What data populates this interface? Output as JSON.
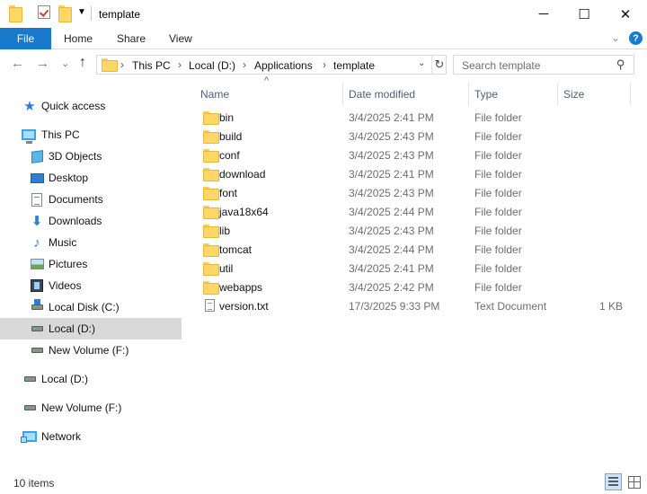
{
  "window": {
    "title": "template",
    "controls": {
      "minimize": "─",
      "maximize": "☐",
      "close": "✕"
    }
  },
  "ribbon": {
    "tabs": [
      "File",
      "Home",
      "Share",
      "View"
    ],
    "collapse_icon": "chevron-down-icon",
    "help_label": "?"
  },
  "address_bar": {
    "breadcrumbs": [
      "This PC",
      "Local (D:)",
      "Applications",
      "template"
    ],
    "separator": "›",
    "dropdown_glyph": "⌄",
    "refresh_glyph": "↻"
  },
  "search": {
    "placeholder": "Search template"
  },
  "nav_glyphs": {
    "back": "←",
    "forward": "→",
    "recent": "⌄",
    "up": "↑"
  },
  "nav_pane": {
    "items": [
      {
        "label": "Quick access",
        "icon": "star-icon"
      },
      {
        "label": "This PC",
        "icon": "computer-icon"
      },
      {
        "label": "3D Objects",
        "icon": "cube-icon"
      },
      {
        "label": "Desktop",
        "icon": "desktop-icon"
      },
      {
        "label": "Documents",
        "icon": "documents-icon"
      },
      {
        "label": "Downloads",
        "icon": "download-icon"
      },
      {
        "label": "Music",
        "icon": "music-icon"
      },
      {
        "label": "Pictures",
        "icon": "pictures-icon"
      },
      {
        "label": "Videos",
        "icon": "videos-icon"
      },
      {
        "label": "Local Disk (C:)",
        "icon": "system-drive-icon"
      },
      {
        "label": "Local (D:)",
        "icon": "drive-icon",
        "selected": true
      },
      {
        "label": "New Volume (F:)",
        "icon": "drive-icon"
      },
      {
        "label": "Local (D:)",
        "icon": "drive-icon"
      },
      {
        "label": "New Volume (F:)",
        "icon": "drive-icon"
      },
      {
        "label": "Network",
        "icon": "network-icon"
      }
    ]
  },
  "file_list": {
    "columns": [
      "Name",
      "Date modified",
      "Type",
      "Size"
    ],
    "sort_glyph": "^",
    "rows": [
      {
        "name": "bin",
        "date": "3/4/2025 2:41 PM",
        "type": "File folder",
        "size": "",
        "icon": "folder-icon"
      },
      {
        "name": "build",
        "date": "3/4/2025 2:43 PM",
        "type": "File folder",
        "size": "",
        "icon": "folder-icon"
      },
      {
        "name": "conf",
        "date": "3/4/2025 2:43 PM",
        "type": "File folder",
        "size": "",
        "icon": "folder-icon"
      },
      {
        "name": "download",
        "date": "3/4/2025 2:41 PM",
        "type": "File folder",
        "size": "",
        "icon": "folder-icon"
      },
      {
        "name": "font",
        "date": "3/4/2025 2:43 PM",
        "type": "File folder",
        "size": "",
        "icon": "folder-icon"
      },
      {
        "name": "java18x64",
        "date": "3/4/2025 2:44 PM",
        "type": "File folder",
        "size": "",
        "icon": "folder-icon"
      },
      {
        "name": "lib",
        "date": "3/4/2025 2:43 PM",
        "type": "File folder",
        "size": "",
        "icon": "folder-icon"
      },
      {
        "name": "tomcat",
        "date": "3/4/2025 2:44 PM",
        "type": "File folder",
        "size": "",
        "icon": "folder-icon"
      },
      {
        "name": "util",
        "date": "3/4/2025 2:41 PM",
        "type": "File folder",
        "size": "",
        "icon": "folder-icon"
      },
      {
        "name": "webapps",
        "date": "3/4/2025 2:42 PM",
        "type": "File folder",
        "size": "",
        "icon": "folder-icon"
      },
      {
        "name": "version.txt",
        "date": "17/3/2025 9:33 PM",
        "type": "Text Document",
        "size": "1 KB",
        "icon": "text-file-icon"
      }
    ]
  },
  "status_bar": {
    "item_count": "10 items"
  },
  "colors": {
    "accent": "#1979ca",
    "selection": "#d9d9d9",
    "header_text": "#4c607a",
    "meta_text": "#6d6d6d"
  }
}
